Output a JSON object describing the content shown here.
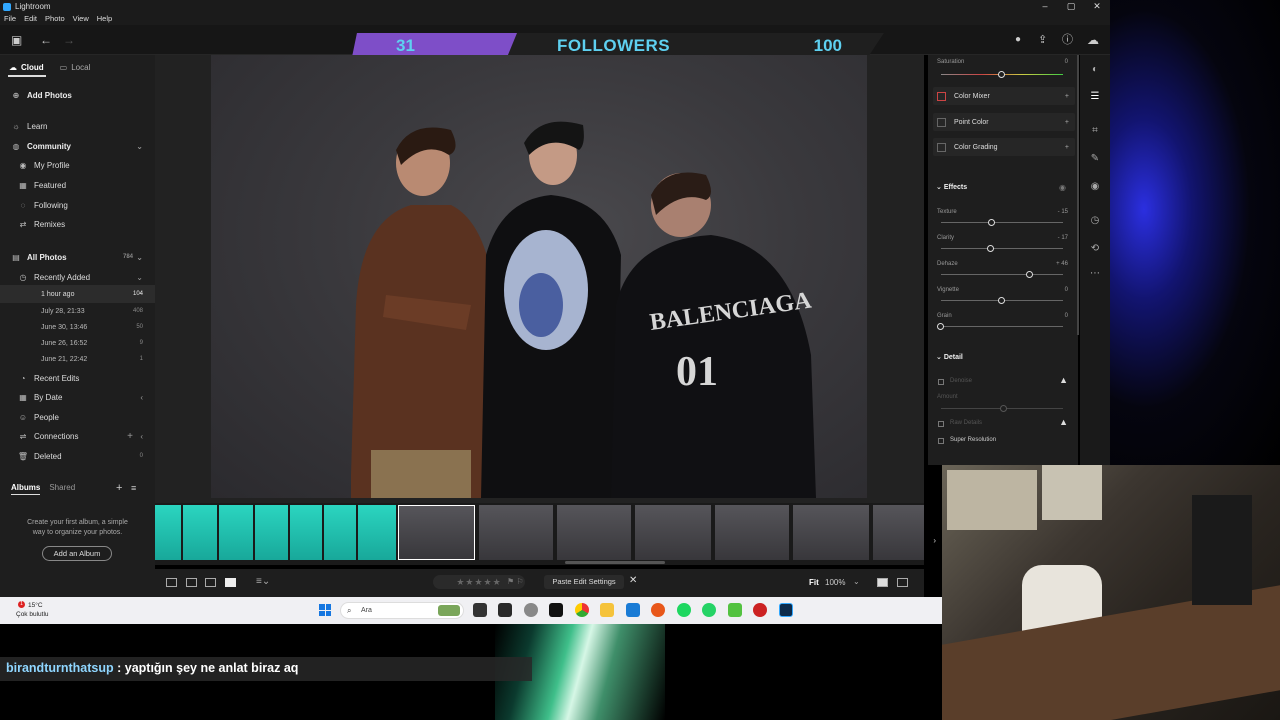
{
  "window": {
    "title": "Lightroom",
    "controls": [
      "–",
      "▢",
      "✕"
    ]
  },
  "menu": [
    "File",
    "Edit",
    "Photo",
    "View",
    "Help"
  ],
  "followers_goal": {
    "current": "31",
    "label": "FOLLOWERS",
    "goal": "100",
    "progress": 0.31
  },
  "left": {
    "tabs": {
      "cloud": "Cloud",
      "local": "Local"
    },
    "add_photos": "Add Photos",
    "learn": "Learn",
    "community": "Community",
    "community_items": [
      "My Profile",
      "Featured",
      "Following",
      "Remixes"
    ],
    "all_photos": {
      "label": "All Photos",
      "count": "784"
    },
    "recently_added": "Recently Added",
    "recent_items": [
      {
        "label": "1 hour ago",
        "count": "104"
      },
      {
        "label": "July 28, 21:33",
        "count": "408"
      },
      {
        "label": "June 30, 13:46",
        "count": "50"
      },
      {
        "label": "June 26, 16:52",
        "count": "9"
      },
      {
        "label": "June 21, 22:42",
        "count": "1"
      }
    ],
    "recent_edits": "Recent Edits",
    "by_date": "By Date",
    "people": "People",
    "connections": "Connections",
    "deleted": {
      "label": "Deleted",
      "count": "0"
    },
    "albums_tab": "Albums",
    "shared_tab": "Shared",
    "albums_message": "Create your first album, a simple way to organize your photos.",
    "add_album": "Add an Album"
  },
  "bottom": {
    "stars": "★★★★★",
    "paste_edit": "Paste Edit Settings",
    "fit": "Fit",
    "zoom": "100%"
  },
  "right": {
    "saturation": {
      "label": "Saturation",
      "value": "0",
      "level": 0.5
    },
    "color_mixer": "Color Mixer",
    "point_color": "Point Color",
    "color_grading": "Color Grading",
    "effects": "Effects",
    "texture": {
      "label": "Texture",
      "value": "- 15",
      "level": 0.42
    },
    "clarity": {
      "label": "Clarity",
      "value": "- 17",
      "level": 0.41
    },
    "dehaze": {
      "label": "Dehaze",
      "value": "+ 46",
      "level": 0.73
    },
    "vignette": {
      "label": "Vignette",
      "value": "0",
      "level": 0.5
    },
    "grain": {
      "label": "Grain",
      "value": "0",
      "level": 0.0
    },
    "detail": "Detail",
    "denoise": "Denoise",
    "amount": "Amount",
    "raw_details": "Raw Details",
    "super_resolution": "Super Resolution"
  },
  "taskbar": {
    "temperature": "15°C",
    "weather": "Çok bulutlu",
    "notif": "1",
    "search_placeholder": "Ara"
  },
  "chat": {
    "username": "birandturnthatsup",
    "message": " : yaptığın şey ne anlat biraz aq"
  },
  "colors": {
    "accent_purple": "#7e4ec8",
    "followers_text": "#5ed0f0",
    "filmstrip_green": "#2bd5c0"
  }
}
